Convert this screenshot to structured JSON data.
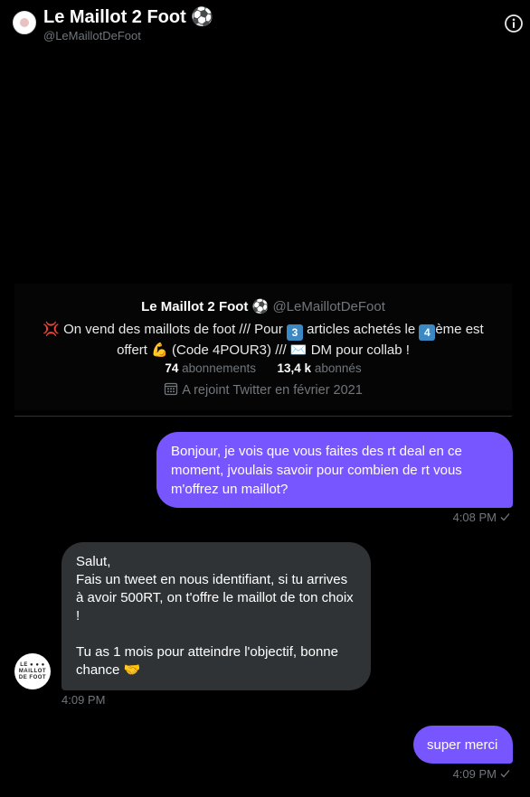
{
  "header": {
    "title": "Le Maillot 2 Foot ⚽",
    "handle": "@LeMaillotDeFoot"
  },
  "profile_card": {
    "name": "Le Maillot 2 Foot ⚽",
    "handle": "@LeMaillotDeFoot",
    "bio_part1": "💢 On vend des maillots de foot /// Pour ",
    "bio_num1": "3",
    "bio_part2": " articles achetés le ",
    "bio_num2": "4",
    "bio_part3": "ème est offert 💪 (Code 4POUR3) /// ✉️ DM pour collab !",
    "following_count": "74",
    "following_label": "abonnements",
    "followers_count": "13,4 k",
    "followers_label": "abonnés",
    "joined": "A rejoint Twitter en février 2021"
  },
  "messages": [
    {
      "direction": "sent",
      "text": "Bonjour, je vois que vous faites des rt deal en ce moment, jvoulais savoir pour combien de rt vous m'offrez un maillot?",
      "time": "4:08 PM"
    },
    {
      "direction": "received",
      "line1": "Salut,",
      "line2": "Fais un tweet en nous identifiant, si tu arrives à avoir 500RT, on t'offre le maillot de ton choix !",
      "line3": "Tu as 1 mois pour atteindre l'objectif, bonne chance 🤝",
      "time": "4:09 PM"
    },
    {
      "direction": "sent",
      "text": "super merci",
      "time": "4:09 PM"
    }
  ],
  "avatar_logo": {
    "line1": "LE ● ● ●",
    "line2": "MAILLOT",
    "line3": "DE FOOT"
  },
  "colors": {
    "sent_bubble": "#7856ff",
    "received_bubble": "#2f3336",
    "background": "#000000",
    "muted_text": "#71767b"
  }
}
